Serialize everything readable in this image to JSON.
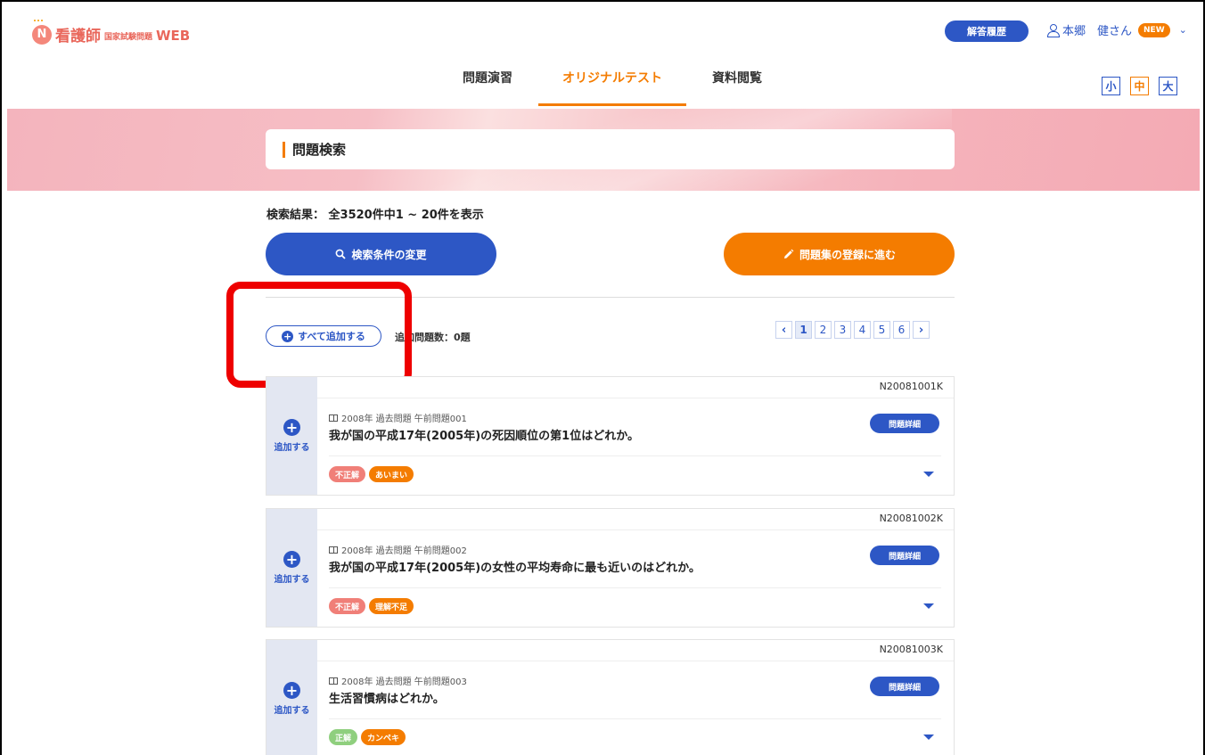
{
  "header": {
    "logo_main": "看護師",
    "logo_sub": "国家試験問題",
    "logo_web": "WEB",
    "logo_mark": "N",
    "history_button": "解答履歴",
    "user_name": "本郷　健さん",
    "new_badge": "NEW",
    "font_sizes": [
      "小",
      "中",
      "大"
    ]
  },
  "nav": {
    "tabs": [
      {
        "label": "問題演習"
      },
      {
        "label": "オリジナルテスト"
      },
      {
        "label": "資料閲覧"
      }
    ]
  },
  "search": {
    "title": "問題検索",
    "result_text": "検索結果： 全3520件中1 ~ 20件を表示",
    "change_button": "検索条件の変更",
    "register_button": "問題集の登録に進む",
    "add_all_button": "すべて追加する",
    "added_count": "追加問題数：0題"
  },
  "pagination": {
    "pages": [
      "1",
      "2",
      "3",
      "4",
      "5",
      "6"
    ],
    "current": "1"
  },
  "cards": [
    {
      "id": "N20081001K",
      "meta": "2008年 過去問題 午前問題001",
      "question": "我が国の平成17年(2005年)の死因順位の第1位はどれか。",
      "add_label": "追加する",
      "detail_button": "問題詳細",
      "tags": [
        {
          "label": "不正解",
          "color": "#f07f78"
        },
        {
          "label": "あいまい",
          "color": "#f47c00"
        }
      ]
    },
    {
      "id": "N20081002K",
      "meta": "2008年 過去問題 午前問題002",
      "question": "我が国の平成17年(2005年)の女性の平均寿命に最も近いのはどれか。",
      "add_label": "追加する",
      "detail_button": "問題詳細",
      "tags": [
        {
          "label": "不正解",
          "color": "#f07f78"
        },
        {
          "label": "理解不足",
          "color": "#f47c00"
        }
      ]
    },
    {
      "id": "N20081003K",
      "meta": "2008年 過去問題 午前問題003",
      "question": "生活習慣病はどれか。",
      "add_label": "追加する",
      "detail_button": "問題詳細",
      "tags": [
        {
          "label": "正解",
          "color": "#8fcf7e"
        },
        {
          "label": "カンペキ",
          "color": "#f47c00"
        }
      ]
    }
  ],
  "colors": {
    "primary": "#2d57c5",
    "accent": "#f47c00",
    "highlight": "#ee0000"
  }
}
